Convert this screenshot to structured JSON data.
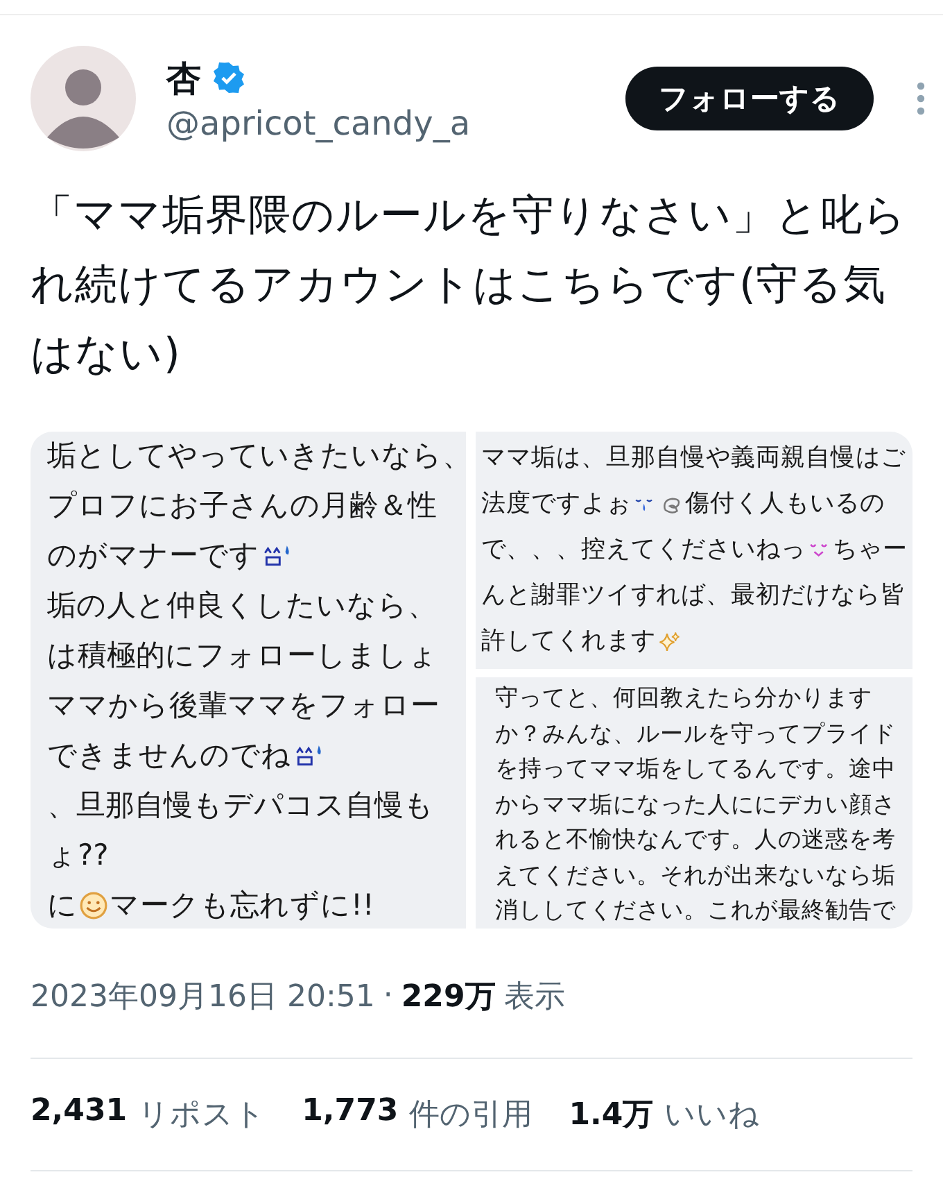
{
  "author": {
    "name": "杏",
    "verified": true,
    "handle": "@apricot_candy_a"
  },
  "follow_button": "フォローする",
  "tweet_text": "「ママ垢界隈のルールを守りなさい」と叱られ続けてるアカウントはこちらです(守る気はない)",
  "media": [
    {
      "lines": [
        [
          {
            "kind": "text",
            "text": "垢としてやっていきたいなら、"
          }
        ],
        [
          {
            "kind": "text",
            "text": "プロフにお子さんの月齢＆性"
          }
        ],
        [
          {
            "kind": "text",
            "text": "のがマナーです"
          },
          {
            "kind": "sweat"
          }
        ],
        [
          {
            "kind": "text",
            "text": "垢の人と仲良くしたいなら、"
          }
        ],
        [
          {
            "kind": "text",
            "text": "は積極的にフォローしましょ"
          }
        ],
        [
          {
            "kind": "text",
            "text": "ママから後輩ママをフォロー"
          }
        ],
        [
          {
            "kind": "text",
            "text": "できませんのでね"
          },
          {
            "kind": "sweat"
          }
        ],
        [
          {
            "kind": "text",
            "text": "、旦那自慢もデパコス自慢も"
          }
        ],
        [
          {
            "kind": "text",
            "text": "ょ??"
          }
        ],
        [
          {
            "kind": "text",
            "text": "に"
          },
          {
            "kind": "smiley"
          },
          {
            "kind": "text",
            "text": "マークも忘れずに!!"
          }
        ]
      ]
    },
    {
      "lines": [
        [
          {
            "kind": "text",
            "text": "ママ垢は、旦那自慢や義両親自慢はご"
          }
        ],
        [
          {
            "kind": "text",
            "text": "法度ですよぉ"
          },
          {
            "kind": "tear"
          },
          {
            "kind": "swirl"
          },
          {
            "kind": "text",
            "text": "傷付く人もいるの"
          }
        ],
        [
          {
            "kind": "text",
            "text": "で、、、控えてくださいねっ"
          },
          {
            "kind": "blush"
          },
          {
            "kind": "text",
            "text": "ちゃー"
          }
        ],
        [
          {
            "kind": "text",
            "text": "んと謝罪ツイすれば、最初だけなら皆"
          }
        ],
        [
          {
            "kind": "text",
            "text": "許してくれます"
          },
          {
            "kind": "sparkle"
          }
        ]
      ]
    },
    {
      "lines": [
        [
          {
            "kind": "text",
            "text": "守ってと、何回教えたら分かります"
          }
        ],
        [
          {
            "kind": "text",
            "text": "か？みんな、ルールを守ってプライド"
          }
        ],
        [
          {
            "kind": "text",
            "text": "を持ってママ垢をしてるんです。途中"
          }
        ],
        [
          {
            "kind": "text",
            "text": "からママ垢になった人ににデカい顔さ"
          }
        ],
        [
          {
            "kind": "text",
            "text": "れると不愉快なんです。人の迷惑を考"
          }
        ],
        [
          {
            "kind": "text",
            "text": "えてください。それが出来ないなら垢"
          }
        ],
        [
          {
            "kind": "text",
            "text": "消ししてください。これが最終勧告で"
          }
        ]
      ]
    }
  ],
  "meta": {
    "time": "2023年09月16日 20:51",
    "separator": "·",
    "views": "229万",
    "views_label": "表示"
  },
  "stats": [
    {
      "count": "2,431",
      "label": "リポスト"
    },
    {
      "count": "1,773",
      "label": "件の引用"
    },
    {
      "count": "1.4万",
      "label": "いいね"
    }
  ]
}
